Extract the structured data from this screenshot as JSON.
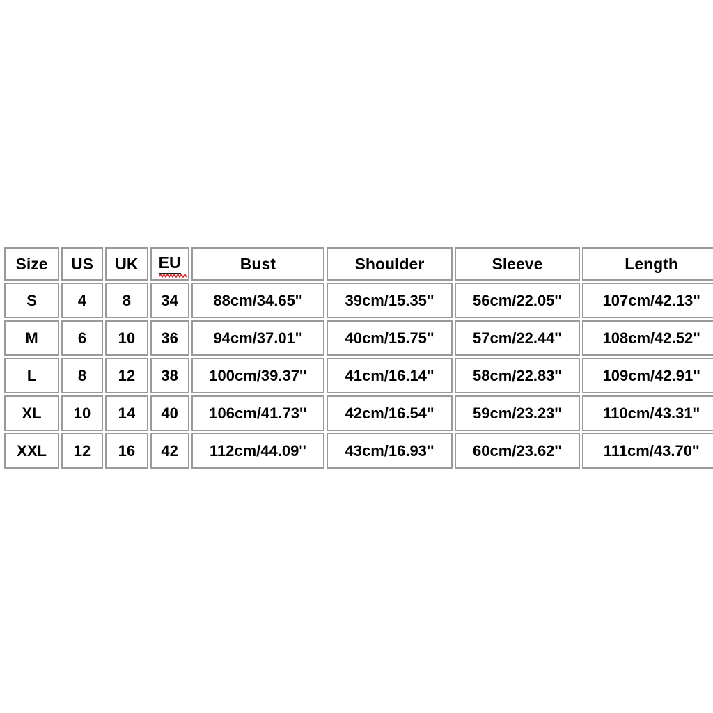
{
  "background_color": "#ffffff",
  "table": {
    "border_color": "#9a9a9a",
    "text_color": "#000000",
    "spellcheck_underline_color": "#e01b1b",
    "columns": [
      {
        "key": "size",
        "label": "Size"
      },
      {
        "key": "us",
        "label": "US"
      },
      {
        "key": "uk",
        "label": "UK",
        "misspelled": false
      },
      {
        "key": "eu",
        "label": "EU",
        "misspelled": true
      },
      {
        "key": "bust",
        "label": "Bust"
      },
      {
        "key": "shoulder",
        "label": "Shoulder"
      },
      {
        "key": "sleeve",
        "label": "Sleeve"
      },
      {
        "key": "length",
        "label": "Length"
      }
    ],
    "rows": [
      {
        "size": "S",
        "us": "4",
        "uk": "8",
        "eu": "34",
        "bust": "88cm/34.65''",
        "shoulder": "39cm/15.35''",
        "sleeve": "56cm/22.05''",
        "length": "107cm/42.13''"
      },
      {
        "size": "M",
        "us": "6",
        "uk": "10",
        "eu": "36",
        "bust": "94cm/37.01''",
        "shoulder": "40cm/15.75''",
        "sleeve": "57cm/22.44''",
        "length": "108cm/42.52''"
      },
      {
        "size": "L",
        "us": "8",
        "uk": "12",
        "eu": "38",
        "bust": "100cm/39.37''",
        "shoulder": "41cm/16.14''",
        "sleeve": "58cm/22.83''",
        "length": "109cm/42.91''"
      },
      {
        "size": "XL",
        "us": "10",
        "uk": "14",
        "eu": "40",
        "bust": "106cm/41.73''",
        "shoulder": "42cm/16.54''",
        "sleeve": "59cm/23.23''",
        "length": "110cm/43.31''"
      },
      {
        "size": "XXL",
        "us": "12",
        "uk": "16",
        "eu": "42",
        "bust": "112cm/44.09''",
        "shoulder": "43cm/16.93''",
        "sleeve": "60cm/23.62''",
        "length": "111cm/43.70''"
      }
    ]
  }
}
